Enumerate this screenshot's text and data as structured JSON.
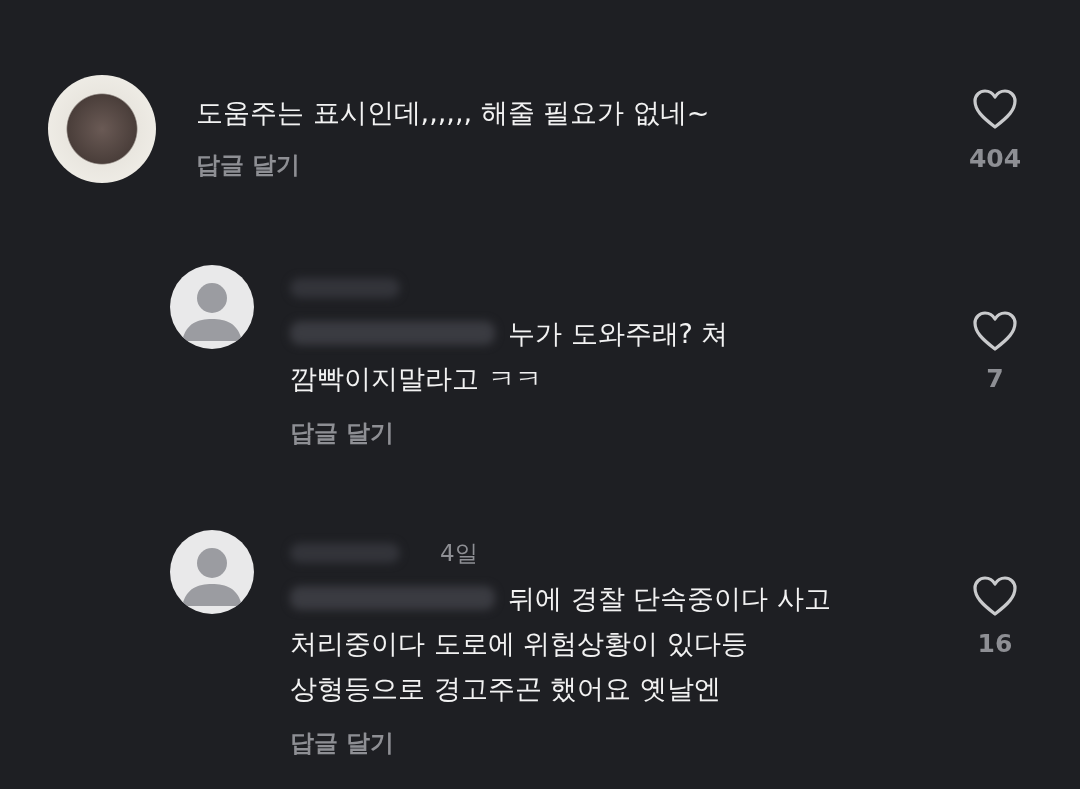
{
  "comments": [
    {
      "kind": "photo",
      "text_lines": [
        "도움주는 표시인데,,,,,, 해줄 필요가 없네~"
      ],
      "reply_label": "답글 달기",
      "likes": "404",
      "children": [
        {
          "kind": "default",
          "text_lines": [
            "누가 도와주래? 쳐",
            "깜빡이지말라고 ㅋㅋ"
          ],
          "reply_label": "답글 달기",
          "likes": "7"
        },
        {
          "kind": "default",
          "time": "4일",
          "text_lines": [
            "뒤에 경찰 단속중이다 사고",
            "처리중이다 도로에 위험상황이 있다등",
            "상형등으로 경고주곤 했어요 옛날엔"
          ],
          "reply_label": "답글 달기",
          "likes": "16"
        }
      ]
    }
  ]
}
